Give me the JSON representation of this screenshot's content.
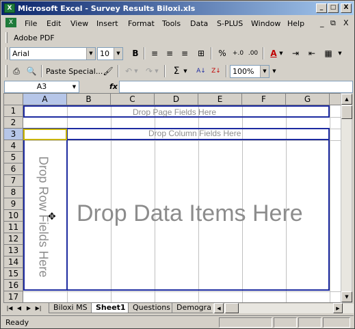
{
  "window": {
    "title": "Microsoft Excel - Survey Results Biloxi.xls",
    "app_icon": "excel-icon",
    "controls": [
      "_",
      "□",
      "X"
    ]
  },
  "menubar": {
    "items": [
      "File",
      "Edit",
      "View",
      "Insert",
      "Format",
      "Tools",
      "Data",
      "S-PLUS",
      "Window",
      "Help"
    ],
    "doc_controls": [
      "_",
      "⧉",
      "X"
    ]
  },
  "pdfbar": {
    "label": "Adobe PDF"
  },
  "format_toolbar": {
    "font": "Arial",
    "size": "10"
  },
  "standard_toolbar": {
    "paste_special": "Paste Special...",
    "zoom": "100%"
  },
  "formula_bar": {
    "name_box": "A3",
    "fx_label": "fx",
    "formula": ""
  },
  "grid": {
    "columns": [
      "A",
      "B",
      "C",
      "D",
      "E",
      "F",
      "G"
    ],
    "rows": [
      "1",
      "2",
      "3",
      "4",
      "5",
      "6",
      "7",
      "8",
      "9",
      "10",
      "11",
      "12",
      "13",
      "14",
      "15",
      "16",
      "17"
    ],
    "selected_column": "A",
    "selected_row": "3"
  },
  "pivot": {
    "page_fields": "Drop Page Fields Here",
    "column_fields": "Drop Column Fields Here",
    "row_fields": "Drop Row Fields Here",
    "data_items": "Drop Data Items Here"
  },
  "sheet_tabs": {
    "tabs": [
      "Biloxi MS",
      "Sheet1",
      "Questions",
      "Demogra"
    ],
    "active": "Sheet1"
  },
  "status": {
    "text": "Ready"
  }
}
